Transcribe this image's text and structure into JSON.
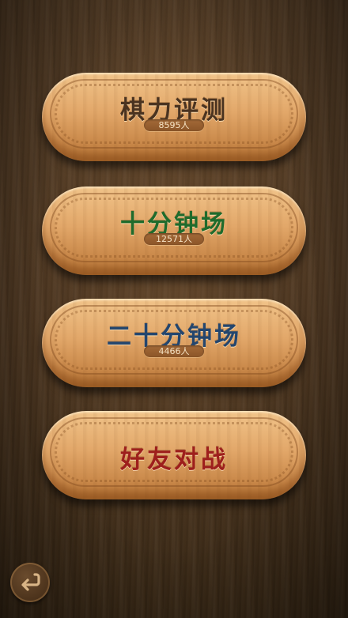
{
  "menu": {
    "items": [
      {
        "label": "棋力评测",
        "count": "8595人",
        "color": "#4a3320"
      },
      {
        "label": "十分钟场",
        "count": "12571人",
        "color": "#1f6b2c"
      },
      {
        "label": "二十分钟场",
        "count": "4466人",
        "color": "#24466e"
      },
      {
        "label": "好友对战",
        "count": "",
        "color": "#9e1f1c"
      }
    ]
  },
  "icons": {
    "back": "back-arrow-icon"
  }
}
